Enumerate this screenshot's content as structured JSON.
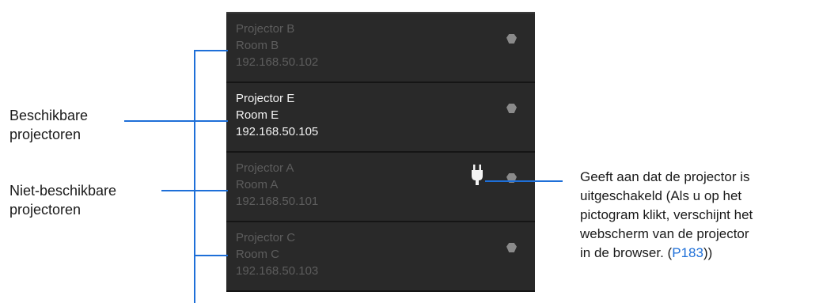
{
  "projectors": [
    {
      "name": "Projector B",
      "room": "Room B",
      "ip": "192.168.50.102",
      "state": "unavailable"
    },
    {
      "name": "Projector E",
      "room": "Room E",
      "ip": "192.168.50.105",
      "state": "available"
    },
    {
      "name": "Projector A",
      "room": "Room A",
      "ip": "192.168.50.101",
      "state": "unavailable",
      "icon": "power-plug-icon"
    },
    {
      "name": "Projector C",
      "room": "Room C",
      "ip": "192.168.50.103",
      "state": "unavailable"
    }
  ],
  "callouts": {
    "available_line1": "Beschikbare",
    "available_line2": "projectoren",
    "unavailable_line1": "Niet-beschikbare",
    "unavailable_line2": "projectoren",
    "power_line1": "Geeft aan dat de projector is",
    "power_line2": "uitgeschakeld (Als u op het",
    "power_line3": "pictogram klikt, verschijnt het",
    "power_line4": "webscherm van de projector",
    "power_line5_prefix": "in de browser. (",
    "power_link": "P183",
    "power_line5_suffix": "))"
  },
  "colors": {
    "panel_bg": "#292929",
    "available_text": "#f2f2f2",
    "unavailable_text": "#5d5d5d",
    "callout_line": "#1e6fd8",
    "link": "#1e6fd8"
  }
}
